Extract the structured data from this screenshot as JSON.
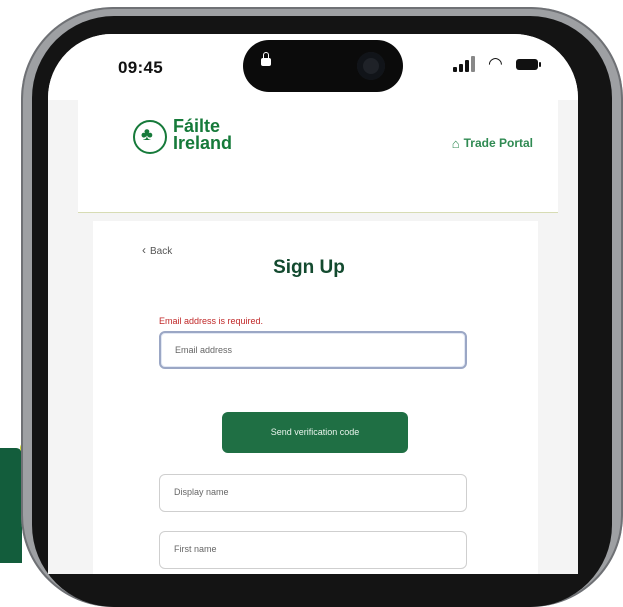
{
  "status_bar": {
    "time": "09:45"
  },
  "header": {
    "logo_line1": "Fáilte",
    "logo_line2": "Ireland",
    "trade_portal": "Trade Portal"
  },
  "form": {
    "back": "Back",
    "title": "Sign Up",
    "error": "Email address is required.",
    "email_placeholder": "Email address",
    "send_button": "Send verification code",
    "display_name_placeholder": "Display name",
    "first_name_placeholder": "First name"
  },
  "colors": {
    "brand_green": "#167a3a",
    "button_green": "#1f6f44",
    "error_red": "#c02828"
  }
}
